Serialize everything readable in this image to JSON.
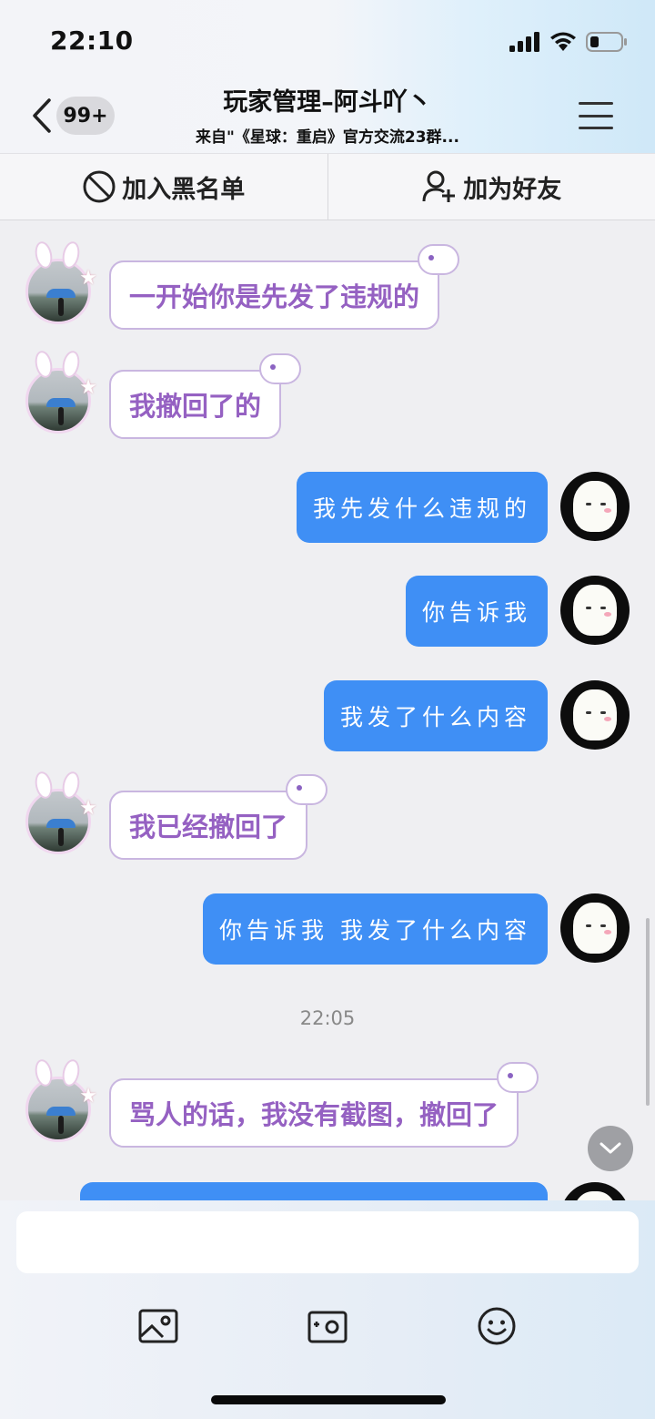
{
  "status_bar": {
    "time": "22:10"
  },
  "header": {
    "badge": "99+",
    "title": "玩家管理–阿斗吖丶",
    "subtitle": "来自\"《星球：重启》官方交流23群..."
  },
  "actions": {
    "blacklist_label": "加入黑名单",
    "add_friend_label": "加为好友"
  },
  "messages": [
    {
      "side": "left",
      "text": "一开始你是先发了违规的"
    },
    {
      "side": "left",
      "text": "我撤回了的"
    },
    {
      "side": "right",
      "text": "我先发什么违规的"
    },
    {
      "side": "right",
      "text": "你告诉我"
    },
    {
      "side": "right",
      "text": "我发了什么内容"
    },
    {
      "side": "left",
      "text": "我已经撤回了"
    },
    {
      "side": "right",
      "text": "你告诉我 我发了什么内容"
    },
    {
      "side": "time",
      "text": "22:05"
    },
    {
      "side": "left",
      "text": "骂人的话，我没有截图，撤回了"
    },
    {
      "side": "right",
      "text": ""
    }
  ],
  "input": {
    "value": "",
    "placeholder": ""
  },
  "toolbar_icons": [
    "image-icon",
    "camera-icon",
    "emoji-icon"
  ]
}
